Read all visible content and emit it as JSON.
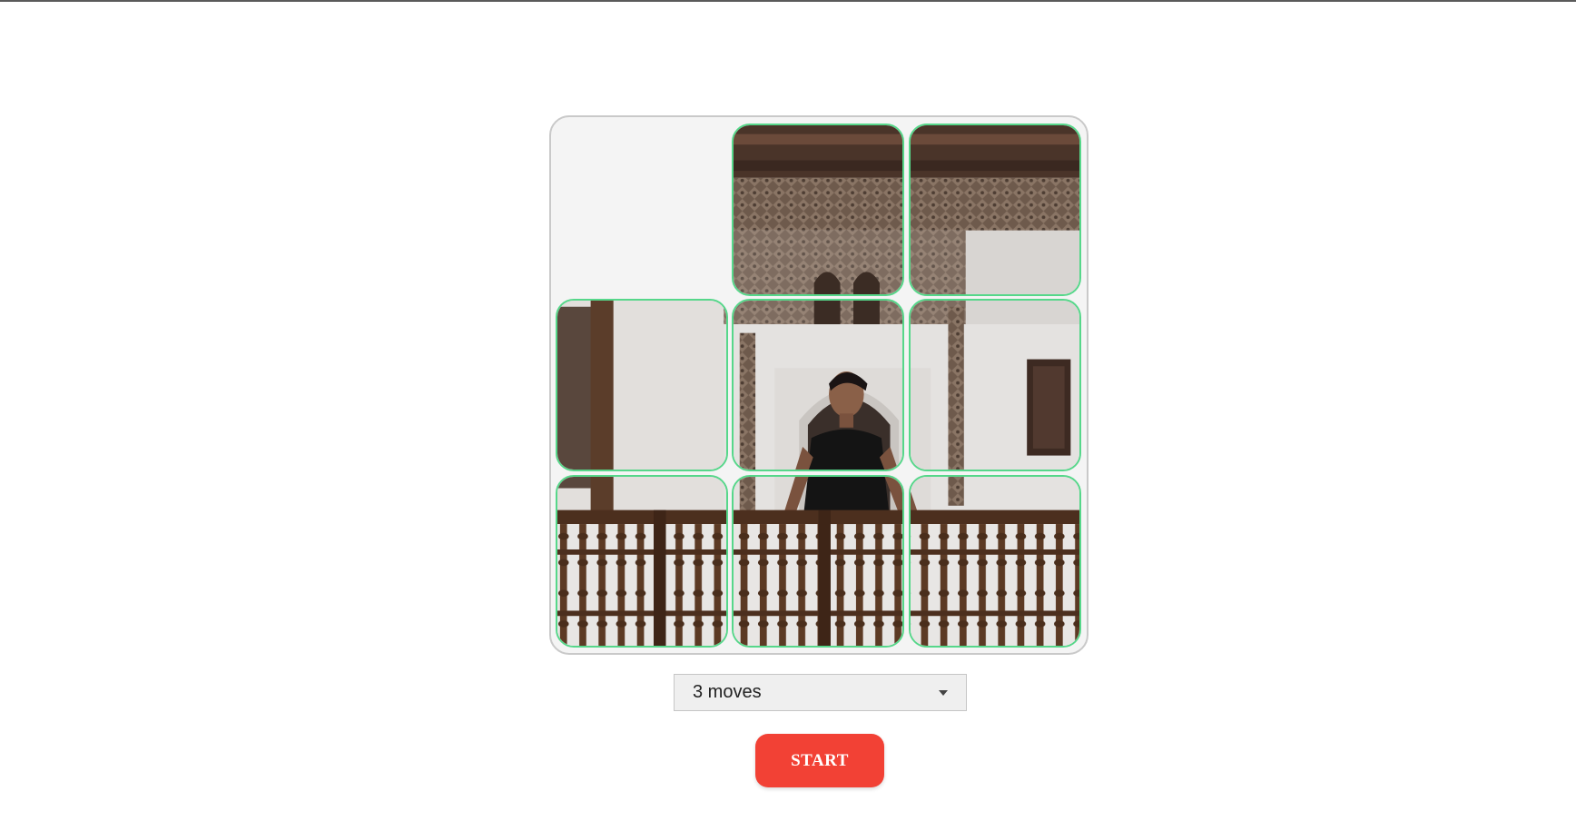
{
  "puzzle": {
    "grid_size": 3,
    "empty_cell": "top-left",
    "tile_border_color": "#56d78a",
    "tiles": [
      {
        "id": "tile-r0c1",
        "piece": "top-center"
      },
      {
        "id": "tile-r0c2",
        "piece": "top-right"
      },
      {
        "id": "tile-r1c0",
        "piece": "middle-left"
      },
      {
        "id": "tile-r1c1",
        "piece": "middle-center"
      },
      {
        "id": "tile-r1c2",
        "piece": "middle-right"
      },
      {
        "id": "tile-r2c0",
        "piece": "bottom-left"
      },
      {
        "id": "tile-r2c1",
        "piece": "bottom-center"
      },
      {
        "id": "tile-r2c2",
        "piece": "bottom-right"
      }
    ]
  },
  "controls": {
    "moves_select_value": "3 moves",
    "start_label": "START",
    "start_color": "#f24135"
  }
}
